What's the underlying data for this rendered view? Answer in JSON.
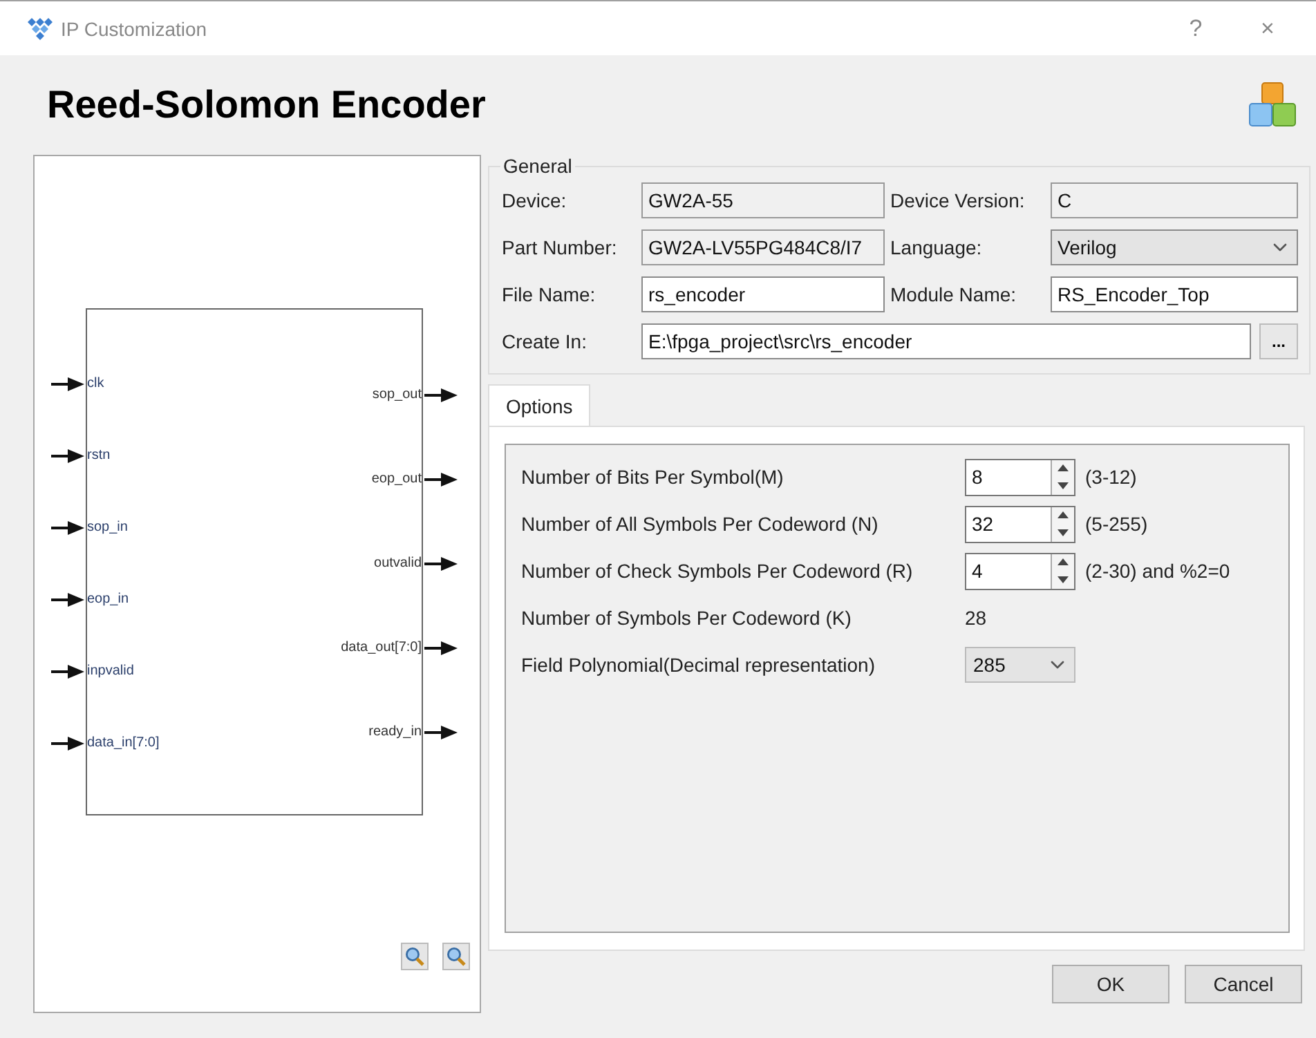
{
  "window": {
    "title": "IP Customization",
    "controls": [
      "?",
      "×"
    ]
  },
  "heading": "Reed-Solomon Encoder",
  "preview": {
    "inputs": [
      "clk",
      "rstn",
      "sop_in",
      "eop_in",
      "inpvalid",
      "data_in[7:0]"
    ],
    "outputs": [
      "sop_out",
      "eop_out",
      "outvalid",
      "data_out[7:0]",
      "ready_in"
    ]
  },
  "general": {
    "title": "General",
    "fields": [
      {
        "label": "Device:",
        "value": "GW2A-55",
        "kind": "readonly"
      },
      {
        "label": "Device Version:",
        "value": "C",
        "kind": "readonly"
      },
      {
        "label": "Part Number:",
        "value": "GW2A-LV55PG484C8/I7",
        "kind": "readonly"
      },
      {
        "label": "Language:",
        "value": "Verilog",
        "kind": "select"
      },
      {
        "label": "File Name:",
        "value": "rs_encoder",
        "kind": "text"
      },
      {
        "label": "Module Name:",
        "value": "RS_Encoder_Top",
        "kind": "text"
      },
      {
        "label": "Create In:",
        "value": "E:\\fpga_project\\src\\rs_encoder",
        "kind": "path",
        "button": "..."
      }
    ]
  },
  "tabs": [
    {
      "label": "Options",
      "selected": true
    }
  ],
  "options": [
    {
      "label": "Number of Bits Per Symbol(M)",
      "value": "8",
      "hint": "(3-12)",
      "kind": "spin"
    },
    {
      "label": "Number of All Symbols Per Codeword (N)",
      "value": "32",
      "hint": "(5-255)",
      "kind": "spin"
    },
    {
      "label": "Number of Check Symbols Per Codeword (R)",
      "value": "4",
      "hint": "(2-30) and %2=0",
      "kind": "spin"
    },
    {
      "label": "Number of Symbols Per Codeword (K)",
      "value": "28",
      "kind": "value"
    },
    {
      "label": "Field Polynomial(Decimal representation)",
      "value": "285",
      "kind": "select"
    }
  ],
  "buttons": [
    "OK",
    "Cancel"
  ]
}
